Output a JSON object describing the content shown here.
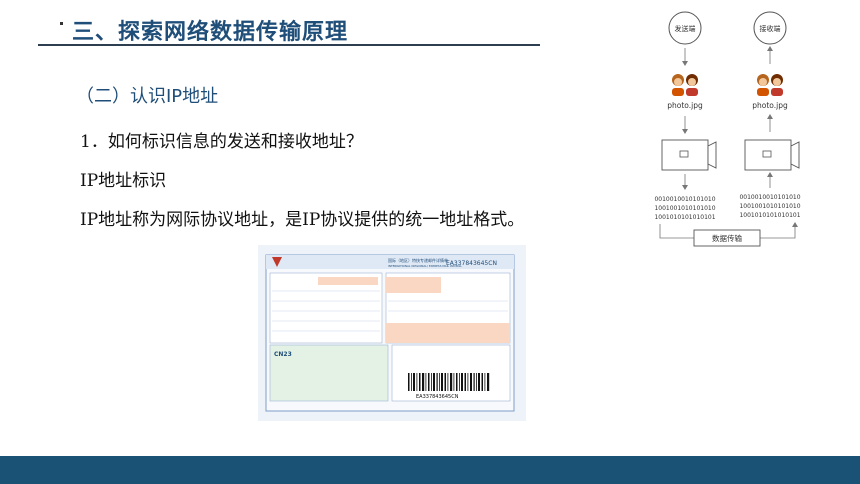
{
  "slide": {
    "title": "三、探索网络数据传输原理",
    "subtitle": "（二）认识IP地址",
    "question": "1．如何标识信息的发送和接收地址？",
    "line2": "IP地址标识",
    "line3": "IP地址称为网际协议地址，是IP协议提供的统一地址格式。"
  },
  "diagram": {
    "sender_label": "发送端",
    "receiver_label": "接收端",
    "file_left": "photo.jpg",
    "file_right": "photo.jpg",
    "bits_left": [
      "0010010010101010",
      "1001001010101010",
      "1001010101010101"
    ],
    "bits_right": [
      "0010010010101010",
      "1001001010101010",
      "1001010101010101"
    ],
    "transfer_label": "数据传输"
  },
  "waybill": {
    "tracking": "EA337843645CN",
    "header": "国际（地区）特快专递邮件详情单",
    "subheader": "INTERNATIONAL (REGIONAL) EXPRESS MAIL WAYBILL",
    "cn_code": "CN23"
  },
  "colors": {
    "title": "#1f4e79",
    "footer": "#1a5276",
    "rule": "#2c3e50"
  }
}
